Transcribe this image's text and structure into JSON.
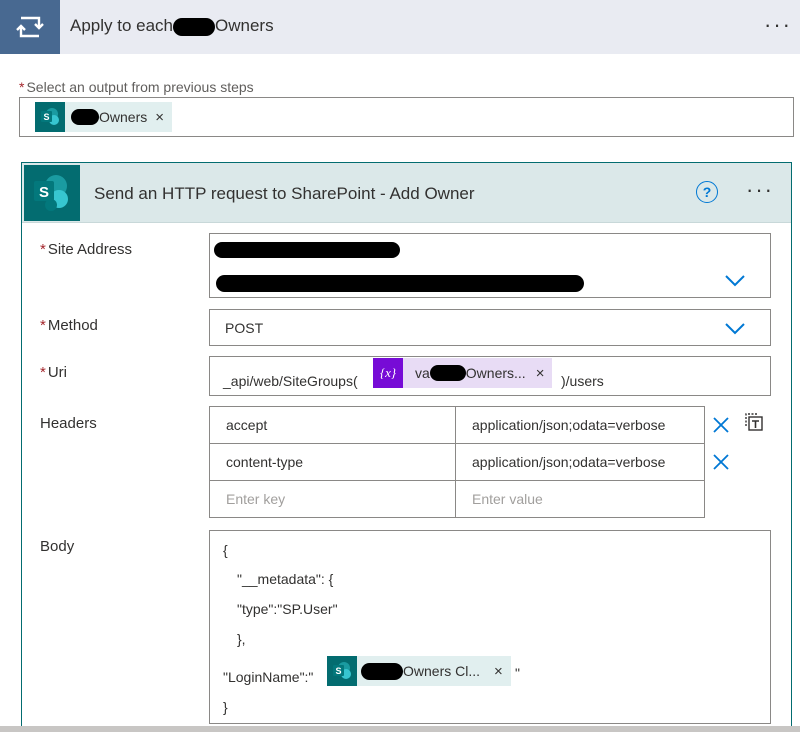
{
  "loop": {
    "title_prefix": "Apply to each",
    "title_suffix": "Owners",
    "more": "···"
  },
  "select_output": {
    "required_mark": "*",
    "label": "Select an output from previous steps",
    "token_text": "Owners",
    "token_close": "×"
  },
  "action": {
    "title": "Send an HTTP request to SharePoint - Add Owner",
    "help": "?",
    "more": "···",
    "icon_letter": "S",
    "fields": {
      "site_address": {
        "required_mark": "*",
        "label": "Site Address"
      },
      "method": {
        "required_mark": "*",
        "label": "Method",
        "value": "POST"
      },
      "uri": {
        "required_mark": "*",
        "label": "Uri",
        "prefix": "_api/web/SiteGroups(",
        "token_icon": "{x}",
        "token_text_a": "va",
        "token_text_b": "Owners...",
        "token_close": "×",
        "suffix": ")/users"
      },
      "headers": {
        "label": "Headers",
        "rows": [
          {
            "key": "accept",
            "value": "application/json;odata=verbose"
          },
          {
            "key": "content-type",
            "value": "application/json;odata=verbose"
          }
        ],
        "key_placeholder": "Enter key",
        "value_placeholder": "Enter value"
      },
      "body": {
        "label": "Body",
        "lines": [
          "{",
          "\"__metadata\": {",
          "\"type\":\"SP.User\"",
          "},",
          "\"LoginName\":\"",
          "}"
        ],
        "token_text": "Owners Cl...",
        "token_close": "×",
        "after_token": "\""
      }
    }
  },
  "colors": {
    "sharepoint_teal": "#036c70",
    "loop_blue": "#486991",
    "header_teal_bg": "#dbe8e9",
    "variable_purple": "#770bd6",
    "link_blue": "#0078d4",
    "required_red": "#a4262c"
  },
  "icons": {
    "loop": "loop-icon",
    "sharepoint": "sharepoint-icon",
    "variable": "variable-icon",
    "help": "help-icon",
    "chevron": "chevron-down-icon",
    "close": "close-icon",
    "switch_mode": "switch-to-text-mode-icon"
  }
}
